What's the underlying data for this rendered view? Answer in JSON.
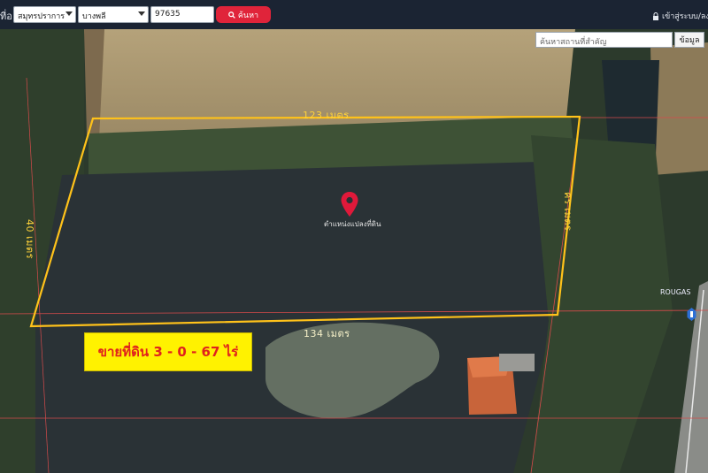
{
  "toolbar": {
    "cut_label": "ที่อ",
    "province_value": "สมุทรปราการ",
    "district_value": "บางพลี",
    "code_value": "97635",
    "search_label": "ค้นหา",
    "login_label": "เข้าสู่ระบบ/ลงทะเ"
  },
  "map_search": {
    "placeholder": "ค้นหาสถานที่สำคัญ",
    "button_label": "ข้อมูล"
  },
  "parcel": {
    "top_length": "123 เมตร",
    "bottom_length": "134 เมตร",
    "left_length": "40 เมตร",
    "right_length": "คร เมตร",
    "marker_label": "ตำแหน่งแปลงที่ดิน",
    "sale_text": "ขายที่ดิน 3 - 0 - 67 ไร่",
    "outline_color": "#ffc21a"
  },
  "map_labels": {
    "road_label": "ROUGAS"
  },
  "icons": {
    "search": "search-icon",
    "lock": "lock-icon",
    "pin": "map-pin-icon",
    "road_sign": "road-sign-icon"
  }
}
